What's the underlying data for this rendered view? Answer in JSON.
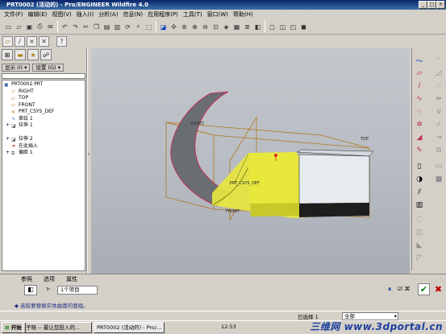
{
  "window": {
    "title": "PRT0002 (活动的) - Pro/ENGINEER Wildfire 4.0"
  },
  "menu": [
    "文件(F)",
    "编辑(E)",
    "视图(V)",
    "插入(I)",
    "分析(A)",
    "信息(N)",
    "应用程序(P)",
    "工具(T)",
    "窗口(W)",
    "帮助(H)"
  ],
  "navigator": {
    "show_label": "显示 (I) ▾",
    "settings_label": "设置 (G) ▾"
  },
  "tree": [
    {
      "label": "PRT0002.PRT",
      "icon": "part-icon",
      "indent": 0
    },
    {
      "label": "RIGHT",
      "icon": "plane-icon",
      "indent": 1
    },
    {
      "label": "TOP",
      "icon": "plane-icon",
      "indent": 1
    },
    {
      "label": "FRONT",
      "icon": "plane-icon",
      "indent": 1
    },
    {
      "label": "PRT_CSYS_DEF",
      "icon": "csys-icon",
      "indent": 1
    },
    {
      "label": "草绘 1",
      "icon": "sketch-icon",
      "indent": 1
    },
    {
      "label": "拉伸 1",
      "icon": "extrude-icon",
      "indent": 1,
      "expand": "+"
    },
    {
      "label": "",
      "icon": "",
      "indent": 1
    },
    {
      "label": "拉伸 2",
      "icon": "extrude-icon",
      "indent": 1,
      "expand": "+"
    },
    {
      "label": "在此插入",
      "icon": "insert-icon",
      "indent": 1
    },
    {
      "label": "偏距 1",
      "icon": "offset-icon",
      "indent": 1,
      "expand": "+"
    }
  ],
  "viewport": {
    "labels": {
      "right": "RIGHT",
      "top": "TOP",
      "front": "FRONT",
      "csys": "PRT_CSYS_DEF"
    }
  },
  "dashboard": {
    "tabs": [
      "参照",
      "选项",
      "属性"
    ],
    "collector_value": "1个项目"
  },
  "status": {
    "message": "◆ 选取要替换实体曲面的面组。",
    "selected": "已选择 1",
    "filter": "全部"
  },
  "taskbar": {
    "start": "开始",
    "items": [
      "子晓 -- 最让您投入的...",
      "PRT0002 (活动的) - Pro/..."
    ],
    "clock": "12:53"
  },
  "watermark": "三维网 www.3dportal.cn",
  "colors": {
    "selection": "#e8e83c",
    "surface": "#6a6e73",
    "edge": "#c0304f",
    "datum": "#b07820"
  }
}
